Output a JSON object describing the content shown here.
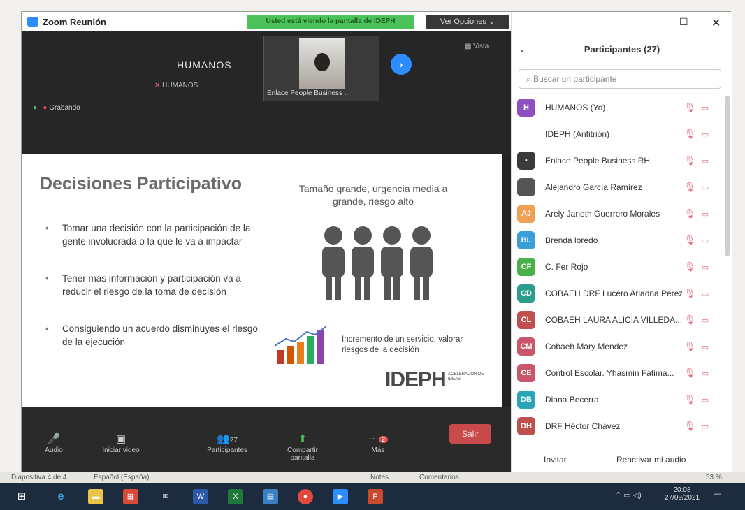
{
  "window": {
    "title": "Zoom Reunión",
    "sharing_banner": "Usted está viendo la pantalla de IDEPH",
    "view_options": "Ver Opciones ⌄"
  },
  "gallery": {
    "self_name": "HUMANOS",
    "self_sub": "HUMANOS",
    "recording": "Grabando",
    "thumb_name": "Enlace People Business ...",
    "view_label": "Vista"
  },
  "slide": {
    "title": "Decisiones Participativo",
    "bullets": [
      "Tomar una decisión con la participación de la gente involucrada o la que le va a impactar",
      "Tener más información y participación va a reducir el riesgo de la toma de decisión",
      "Consiguiendo un acuerdo disminuyes el riesgo de la ejecución"
    ],
    "right_heading": "Tamaño grande, urgencia media a grande, riesgo alto",
    "chart_caption": "Incremento de un servicio, valorar riesgos de la decisión",
    "logo": "IDEPH",
    "logo_sub": "ACELERADOR DE IDEAS"
  },
  "toolbar": {
    "audio": "Audio",
    "video": "Iniciar video",
    "participants": "Participantes",
    "participants_count": "27",
    "share": "Compartir pantalla",
    "more": "Más",
    "more_badge": "2",
    "leave": "Salir"
  },
  "panel": {
    "title": "Participantes (27)",
    "search_placeholder": "Buscar un participante",
    "invite": "Invitar",
    "unmute": "Reactivar mi audio",
    "participants": [
      {
        "initials": "H",
        "name": "HUMANOS (Yo)",
        "color": "#8e4fc2"
      },
      {
        "initials": "",
        "name": "IDEPH (Anfitrión)",
        "color": "#ffffff"
      },
      {
        "initials": "▪",
        "name": "Enlace People Business RH",
        "color": "#3a3a3a"
      },
      {
        "initials": "",
        "name": "Alejandro García Ramírez",
        "color": "#555555"
      },
      {
        "initials": "AJ",
        "name": "Arely Janeth Guerrero Morales",
        "color": "#f0a052"
      },
      {
        "initials": "BL",
        "name": "Brenda loredo",
        "color": "#3a9fd9"
      },
      {
        "initials": "CF",
        "name": "C. Fer Rojo",
        "color": "#4ab04a"
      },
      {
        "initials": "CD",
        "name": "COBAEH DRF Lucero Ariadna Pérez ...",
        "color": "#2a9d8f"
      },
      {
        "initials": "CL",
        "name": "COBAEH LAURA ALICIA VILLEDA...",
        "color": "#c0504d"
      },
      {
        "initials": "CM",
        "name": "Cobaeh Mary Mendez",
        "color": "#c9566a"
      },
      {
        "initials": "CE",
        "name": "Control Escolar. Yhasmin Fátima...",
        "color": "#c9566a"
      },
      {
        "initials": "DB",
        "name": "Diana Becerra",
        "color": "#2aa5b8"
      },
      {
        "initials": "DH",
        "name": "DRF Héctor Chávez",
        "color": "#c0504d"
      }
    ]
  },
  "statusbar": {
    "slide": "Diapositiva 4 de 4",
    "lang": "Español (España)",
    "notes": "Notas",
    "comments": "Comentarios",
    "zoom": "53 %"
  },
  "taskbar": {
    "time": "20:08",
    "date": "27/09/2021"
  }
}
